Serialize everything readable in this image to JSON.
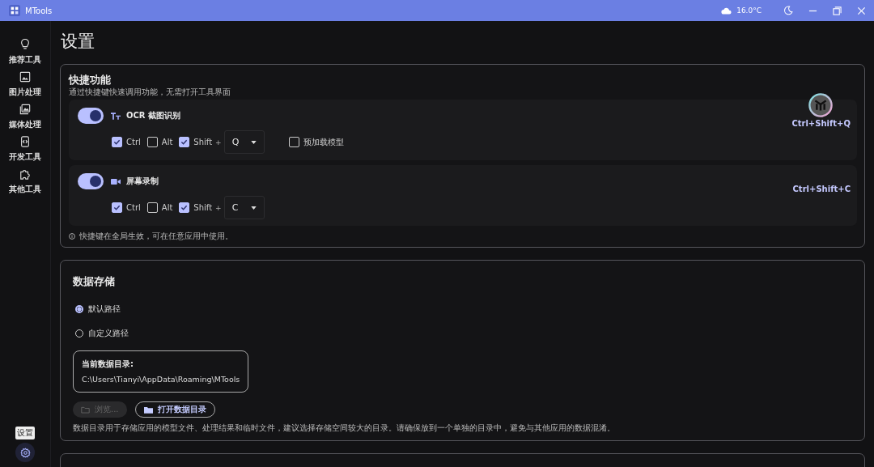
{
  "window": {
    "title": "MTools",
    "weather": "16.0°C"
  },
  "sidebar": {
    "items": [
      {
        "kind": "bulb",
        "label": "推荐工具"
      },
      {
        "kind": "image",
        "label": "图片处理"
      },
      {
        "kind": "gallery",
        "label": "媒体处理"
      },
      {
        "kind": "code",
        "label": "开发工具"
      },
      {
        "kind": "puzzle",
        "label": "其他工具"
      }
    ],
    "settings_tooltip": "设置"
  },
  "page_title": "设置",
  "shortcuts": {
    "title": "快捷功能",
    "subtitle": "通过快捷键快速调用功能，无需打开工具界面",
    "items": [
      {
        "kind": "text",
        "on": true,
        "label": "OCR 截图识别",
        "modifiers": [
          {
            "label": "Ctrl",
            "checked": true
          },
          {
            "label": "Alt",
            "checked": false
          },
          {
            "label": "Shift",
            "checked": true
          }
        ],
        "plus": "+",
        "key": "Q",
        "hotkey": "Ctrl+Shift+Q",
        "extra": {
          "label": "预加载模型",
          "checked": false
        }
      },
      {
        "kind": "camera",
        "on": true,
        "label": "屏幕录制",
        "modifiers": [
          {
            "label": "Ctrl",
            "checked": true
          },
          {
            "label": "Alt",
            "checked": false
          },
          {
            "label": "Shift",
            "checked": true
          }
        ],
        "plus": "+",
        "key": "C",
        "hotkey": "Ctrl+Shift+C"
      }
    ],
    "note": "快捷键在全局生效，可在任意应用中使用。"
  },
  "storage": {
    "title": "数据存储",
    "options": [
      {
        "label": "默认路径",
        "selected": true
      },
      {
        "label": "自定义路径",
        "selected": false
      }
    ],
    "current_label": "当前数据目录:",
    "current_path": "C:\\Users\\Tianyi\\AppData\\Roaming\\MTools",
    "browse": {
      "label": "浏览...",
      "disabled": true
    },
    "open": {
      "label": "打开数据目录"
    },
    "note": "数据目录用于存储应用的模型文件、处理结果和临时文件，建议选择存储空间较大的目录。请确保放到一个单独的目录中，避免与其他应用的数据混淆。"
  }
}
